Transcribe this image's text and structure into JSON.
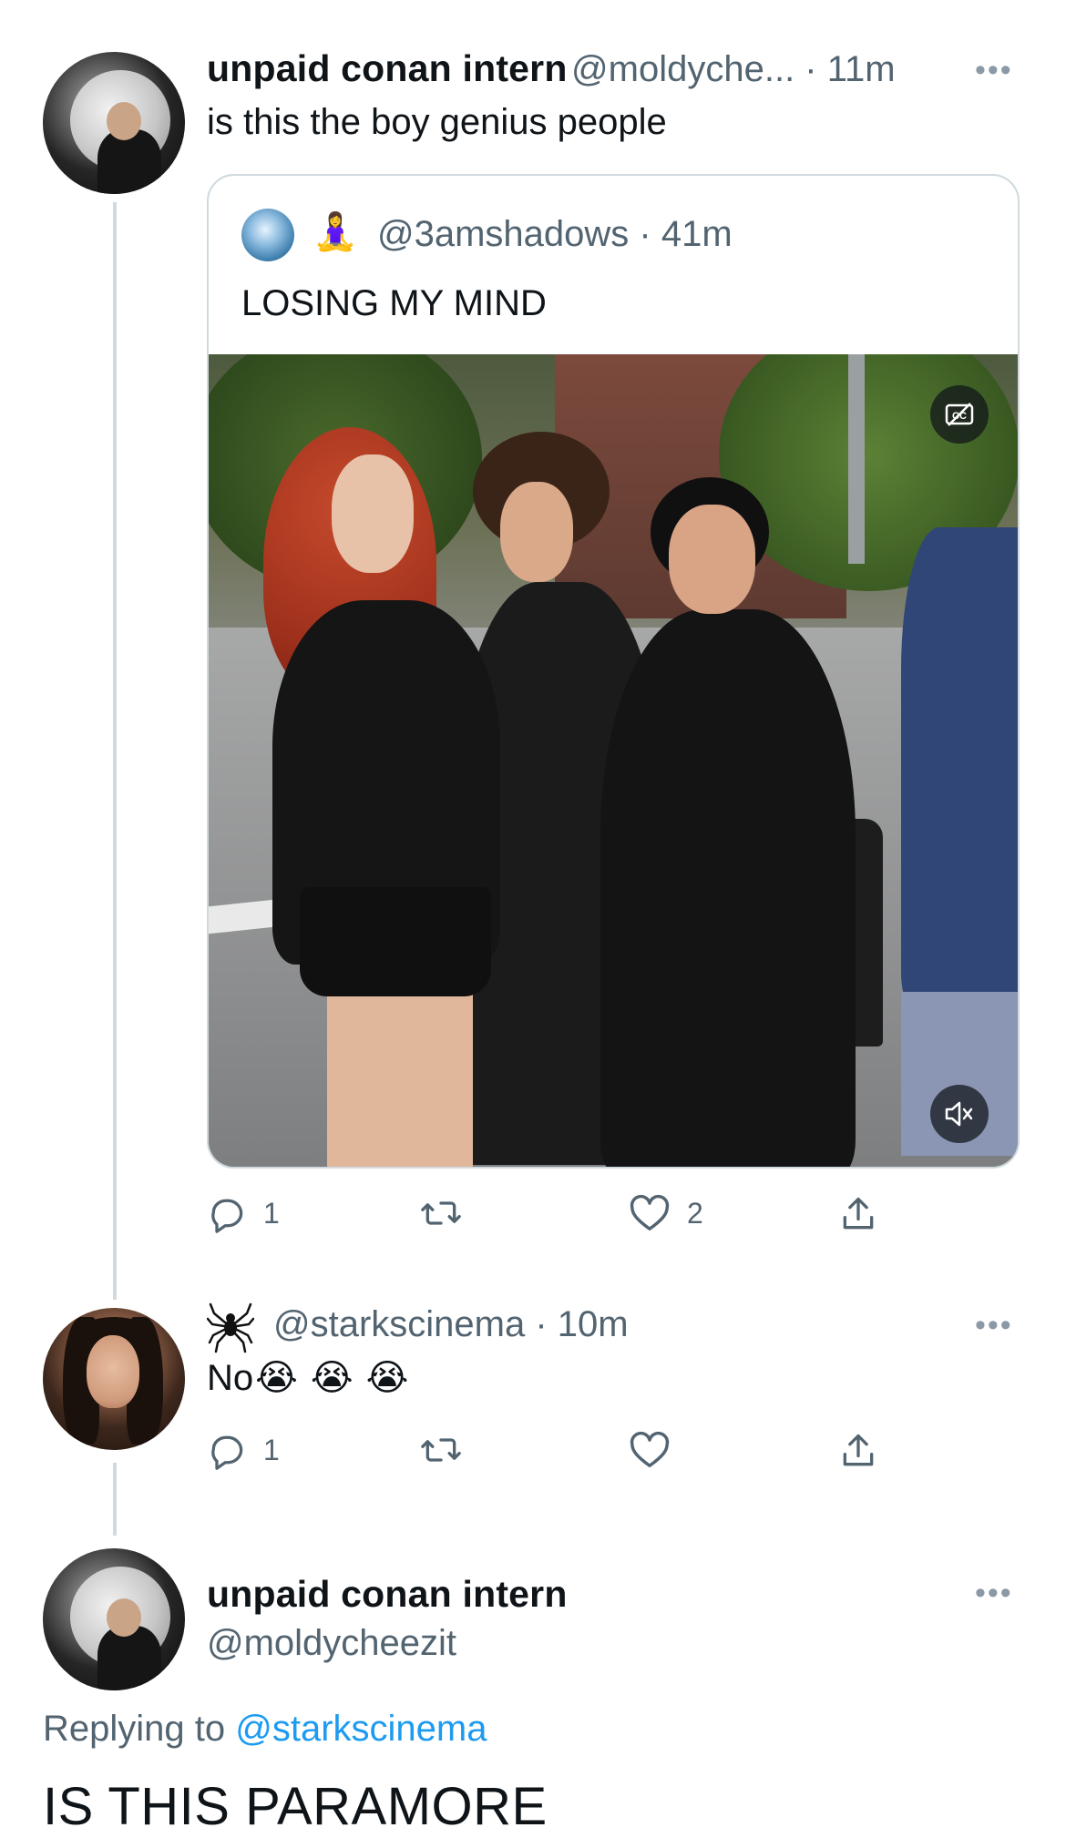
{
  "tweet1": {
    "display_name": "unpaid conan intern",
    "handle_time": "@moldyche... · 11m",
    "text": "is this the boy genius people"
  },
  "quoted": {
    "handle_time": "@3amshadows · 41m",
    "text": "LOSING MY MIND",
    "badge_icon": "cc-icon",
    "sound_icon": "mute-icon",
    "actions": {
      "reply_count": "1",
      "retweet_count": "",
      "like_count": "2"
    }
  },
  "reply1": {
    "handle_time": "@starkscinema · 10m",
    "text": "No",
    "emoji": [
      "😭",
      "😭",
      "😭"
    ],
    "actions": {
      "reply_count": "1",
      "retweet_count": "",
      "like_count": ""
    }
  },
  "reply2": {
    "display_name": "unpaid conan intern",
    "handle": "@moldycheezit",
    "replying_label": "Replying to",
    "replying_to": "@starkscinema",
    "text": "IS THIS PARAMORE"
  },
  "more_label": "•••",
  "colors": {
    "link": "#1d9bf0",
    "muted": "#536471",
    "line": "#cfd9de"
  }
}
